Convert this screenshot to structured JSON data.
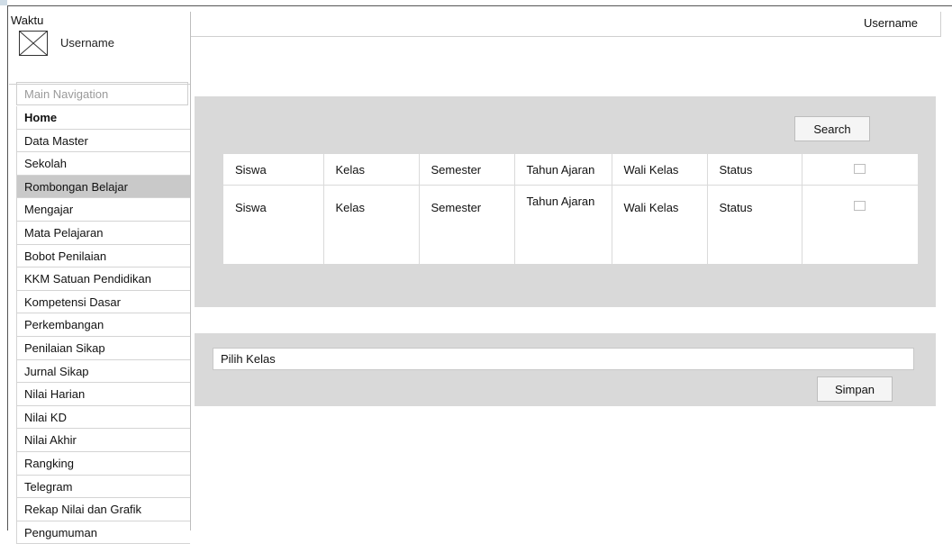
{
  "header": {
    "time_label": "Waktu",
    "username_left": "Username",
    "username_right": "Username"
  },
  "sidebar": {
    "section_title": "Main Navigation",
    "active_item": "Rombongan Belajar",
    "items": [
      {
        "label": "Home"
      },
      {
        "label": "Data Master"
      },
      {
        "label": "Sekolah"
      },
      {
        "label": "Rombongan Belajar"
      },
      {
        "label": "Mengajar"
      },
      {
        "label": "Mata Pelajaran"
      },
      {
        "label": "Bobot Penilaian"
      },
      {
        "label": "KKM Satuan Pendidikan"
      },
      {
        "label": "Kompetensi Dasar"
      },
      {
        "label": "Perkembangan"
      },
      {
        "label": "Penilaian Sikap"
      },
      {
        "label": "Jurnal Sikap"
      },
      {
        "label": "Nilai Harian"
      },
      {
        "label": "Nilai KD"
      },
      {
        "label": "Nilai Akhir"
      },
      {
        "label": "Rangking"
      },
      {
        "label": "Telegram"
      },
      {
        "label": "Rekap Nilai dan Grafik"
      },
      {
        "label": "Pengumuman"
      }
    ]
  },
  "search_panel": {
    "search_button": "Search",
    "rows": [
      {
        "siswa": "Siswa",
        "kelas": "Kelas",
        "semester": "Semester",
        "tahun_ajaran": "Tahun Ajaran",
        "wali_kelas": "Wali Kelas",
        "status": "Status",
        "checked": false
      },
      {
        "siswa": "Siswa",
        "kelas": "Kelas",
        "semester": "Semester",
        "tahun_ajaran": "Tahun Ajaran",
        "wali_kelas": "Wali Kelas",
        "status": "Status",
        "checked": false
      }
    ]
  },
  "kelas_panel": {
    "input_value": "Pilih Kelas",
    "save_button": "Simpan"
  }
}
